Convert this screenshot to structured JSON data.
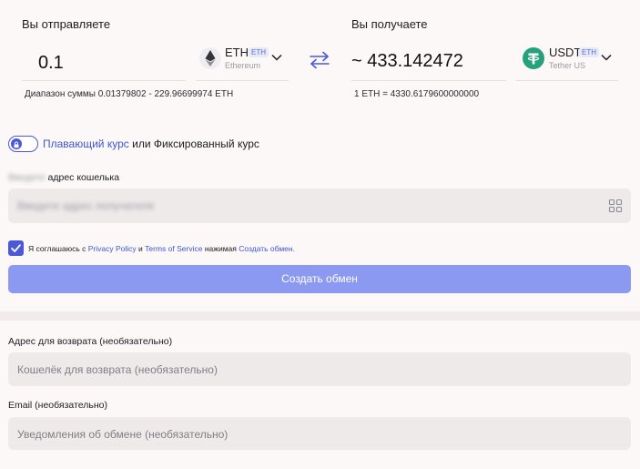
{
  "send": {
    "label": "Вы отправляете",
    "amount": "0.1",
    "currency": {
      "ticker": "ETH",
      "badge": "ETH",
      "network": "Ethereum",
      "icon": "ethereum-icon"
    },
    "range": "Диапазон суммы 0.01379802 - 229.96699974 ETH"
  },
  "swap_icon": "swap-arrows-icon",
  "receive": {
    "label": "Вы получаете",
    "amount_prefix": "~",
    "amount": "433.142472",
    "currency": {
      "ticker": "USDT",
      "badge": "ETH",
      "network": "Tether US",
      "icon": "tether-icon"
    },
    "rate": "1 ETH = 4330.6179600000000"
  },
  "rate_type": {
    "floating": "Плавающий курс",
    "separator": "или",
    "fixed": "Фиксированный курс"
  },
  "wallet": {
    "label_blurred": "Введите",
    "label": "адрес кошелька",
    "placeholder": "Введите адрес получателя"
  },
  "agreement": {
    "prefix": "Я соглашаюсь с",
    "privacy": "Privacy Policy",
    "and": "и",
    "terms": "Terms of Service",
    "pressing": "нажимая",
    "action": "Создать обмен."
  },
  "submit_label": "Создать обмен",
  "refund": {
    "label": "Адрес для возврата (необязательно)",
    "placeholder": "Кошелёк для возврата (необязательно)"
  },
  "email": {
    "label": "Email (необязательно)",
    "placeholder": "Уведомления об обмене (необязательно)"
  },
  "colors": {
    "accent": "#4a58d9",
    "button": "#8b9af0",
    "tether": "#26a17b",
    "background": "#fcf8f7"
  }
}
